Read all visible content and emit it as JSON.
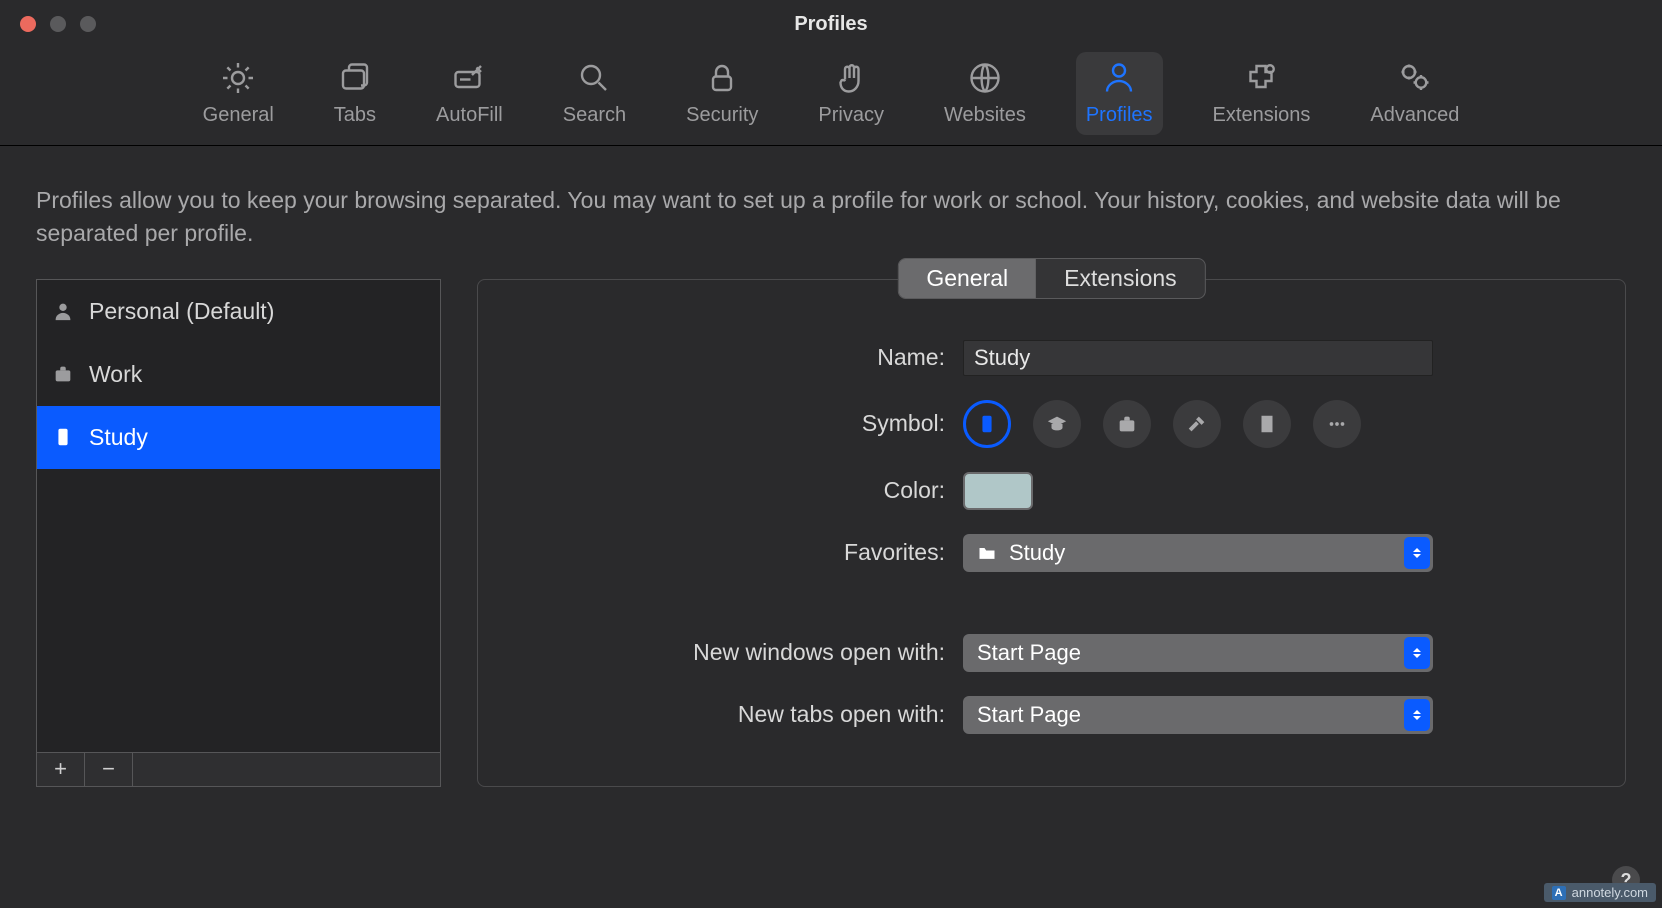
{
  "window": {
    "title": "Profiles"
  },
  "toolbar": {
    "items": [
      {
        "label": "General"
      },
      {
        "label": "Tabs"
      },
      {
        "label": "AutoFill"
      },
      {
        "label": "Search"
      },
      {
        "label": "Security"
      },
      {
        "label": "Privacy"
      },
      {
        "label": "Websites"
      },
      {
        "label": "Profiles"
      },
      {
        "label": "Extensions"
      },
      {
        "label": "Advanced"
      }
    ],
    "active_index": 7
  },
  "description": "Profiles allow you to keep your browsing separated. You may want to set up a profile for work or school. Your history, cookies, and website data will be separated per profile.",
  "profiles": {
    "items": [
      {
        "label": "Personal (Default)",
        "icon": "person"
      },
      {
        "label": "Work",
        "icon": "briefcase"
      },
      {
        "label": "Study",
        "icon": "badge"
      }
    ],
    "selected_index": 2,
    "add_glyph": "+",
    "remove_glyph": "−"
  },
  "subtabs": {
    "items": [
      {
        "label": "General"
      },
      {
        "label": "Extensions"
      }
    ],
    "active_index": 0
  },
  "detail": {
    "name_label": "Name:",
    "name_value": "Study",
    "symbol_label": "Symbol:",
    "symbols": [
      "badge",
      "grad-cap",
      "briefcase",
      "hammer",
      "building",
      "more"
    ],
    "symbol_selected_index": 0,
    "color_label": "Color:",
    "color_value": "#b0c7c8",
    "favorites_label": "Favorites:",
    "favorites_value": "Study",
    "new_windows_label": "New windows open with:",
    "new_windows_value": "Start Page",
    "new_tabs_label": "New tabs open with:",
    "new_tabs_value": "Start Page"
  },
  "help_glyph": "?",
  "watermark": "annotely.com"
}
